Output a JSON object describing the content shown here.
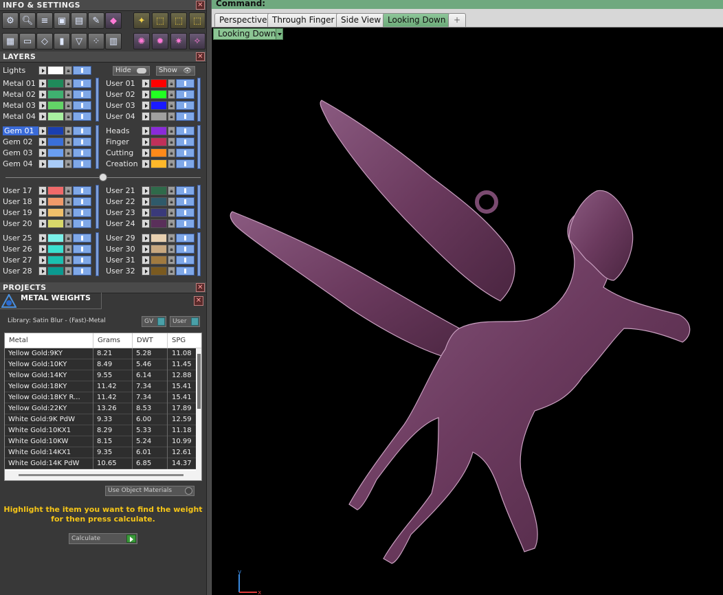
{
  "info_panel": {
    "title": "INFO & SETTINGS",
    "close": "✕"
  },
  "toolbar_icons": [
    "gear-icon",
    "magnifier-icon",
    "layers-stack-icon",
    "cube-icon",
    "document-icon",
    "pencil-icon",
    "gem-icon",
    "wand-icon",
    "frame-icon",
    "frame-move-icon",
    "frame-edit-icon",
    "window-grid-icon",
    "monitor-icon",
    "cube-outline-icon",
    "box-icon",
    "funnel-icon",
    "select-points-icon",
    "panel-icon",
    "orbit-icon",
    "snap-icon",
    "target-icon",
    "gem-select-icon"
  ],
  "layers_panel": {
    "title": "LAYERS",
    "close": "✕",
    "lights_label": "Lights",
    "hide_label": "Hide",
    "show_label": "Show",
    "groups": [
      {
        "left": [
          {
            "name": "Metal 01",
            "color": "#1f8a5a"
          },
          {
            "name": "Metal 02",
            "color": "#3fb070"
          },
          {
            "name": "Metal 03",
            "color": "#63d467"
          },
          {
            "name": "Metal 04",
            "color": "#a8f0a0"
          }
        ],
        "right": [
          {
            "name": "User 01",
            "color": "#ff0000"
          },
          {
            "name": "User 02",
            "color": "#22ff22"
          },
          {
            "name": "User 03",
            "color": "#1a1aff"
          },
          {
            "name": "User 04",
            "color": "#a0a0a0"
          }
        ]
      },
      {
        "left": [
          {
            "name": "Gem 01",
            "color": "#1a3fb0",
            "selected": true
          },
          {
            "name": "Gem 02",
            "color": "#3a6fd8"
          },
          {
            "name": "Gem 03",
            "color": "#6a9ef0"
          },
          {
            "name": "Gem 04",
            "color": "#a8cbf7"
          }
        ],
        "right": [
          {
            "name": "Heads",
            "color": "#8a2bd8"
          },
          {
            "name": "Finger",
            "color": "#c0305a"
          },
          {
            "name": "Cutting",
            "color": "#ff8a1a"
          },
          {
            "name": "Creation",
            "color": "#ffb82a"
          }
        ]
      },
      {
        "left": [
          {
            "name": "User 17",
            "color": "#f06a6a"
          },
          {
            "name": "User 18",
            "color": "#f09a6a"
          },
          {
            "name": "User 19",
            "color": "#f0c06a"
          },
          {
            "name": "User 20",
            "color": "#d8d86a"
          }
        ],
        "right": [
          {
            "name": "User 21",
            "color": "#2f6a4a"
          },
          {
            "name": "User 22",
            "color": "#2f5a6a"
          },
          {
            "name": "User 23",
            "color": "#3a3a7a"
          },
          {
            "name": "User 24",
            "color": "#5a2f5a"
          }
        ]
      },
      {
        "left": [
          {
            "name": "User 25",
            "color": "#7af0e8"
          },
          {
            "name": "User 26",
            "color": "#3ae0d0"
          },
          {
            "name": "User 27",
            "color": "#1ac0b0"
          },
          {
            "name": "User 28",
            "color": "#0a9a90"
          }
        ],
        "right": [
          {
            "name": "User 29",
            "color": "#e8d0b0"
          },
          {
            "name": "User 30",
            "color": "#c8a880"
          },
          {
            "name": "User 31",
            "color": "#a07a40"
          },
          {
            "name": "User 32",
            "color": "#7a5a20"
          }
        ]
      }
    ]
  },
  "projects_panel": {
    "title": "PROJECTS",
    "close": "✕"
  },
  "metal_weights": {
    "title": "METAL WEIGHTS",
    "close": "✕",
    "library": "Library: Satin Blur - (Fast)-Metal",
    "gv_label": "GV",
    "user_label": "User",
    "columns": [
      "Metal",
      "Grams",
      "DWT",
      "SPG"
    ],
    "rows": [
      [
        "Yellow Gold:9KY",
        "8.21",
        "5.28",
        "11.08"
      ],
      [
        "Yellow Gold:10KY",
        "8.49",
        "5.46",
        "11.45"
      ],
      [
        "Yellow Gold:14KY",
        "9.55",
        "6.14",
        "12.88"
      ],
      [
        "Yellow Gold:18KY",
        "11.42",
        "7.34",
        "15.41"
      ],
      [
        "Yellow Gold:18KY R...",
        "11.42",
        "7.34",
        "15.41"
      ],
      [
        "Yellow Gold:22KY",
        "13.26",
        "8.53",
        "17.89"
      ],
      [
        "White Gold:9K PdW",
        "9.33",
        "6.00",
        "12.59"
      ],
      [
        "White Gold:10KX1",
        "8.29",
        "5.33",
        "11.18"
      ],
      [
        "White Gold:10KW",
        "8.15",
        "5.24",
        "10.99"
      ],
      [
        "White Gold:14KX1",
        "9.35",
        "6.01",
        "12.61"
      ],
      [
        "White Gold:14K PdW",
        "10.65",
        "6.85",
        "14.37"
      ]
    ],
    "use_object_materials": "Use Object Materials",
    "hint": "Highlight the item you want to find the weight for then press calculate.",
    "calculate": "Calculate"
  },
  "viewport": {
    "command_label": "Command:",
    "tabs": [
      "Perspective",
      "Through Finger",
      "Side View",
      "Looking Down"
    ],
    "active_tab": "Looking Down",
    "add_tab": "+",
    "view_select": "Looking Down",
    "axis_y": "y",
    "axis_x": "x",
    "model_color": "#6b3a5e"
  }
}
